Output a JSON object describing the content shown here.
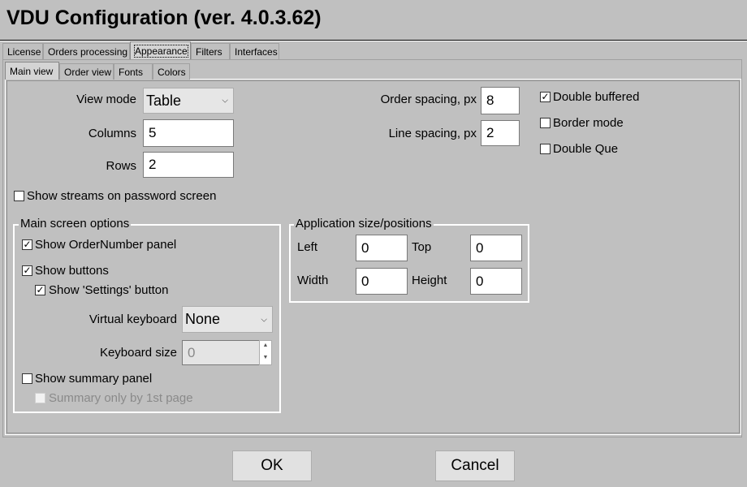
{
  "window": {
    "title": "VDU Configuration (ver. 4.0.3.62)"
  },
  "tabs": [
    {
      "label": "License"
    },
    {
      "label": "Orders processing"
    },
    {
      "label": "Appearance"
    },
    {
      "label": "Filters"
    },
    {
      "label": "Interfaces"
    }
  ],
  "subtabs": [
    {
      "label": "Main view"
    },
    {
      "label": "Order view"
    },
    {
      "label": "Fonts"
    },
    {
      "label": "Colors"
    }
  ],
  "main_view": {
    "view_mode_label": "View mode",
    "view_mode_value": "Table",
    "columns_label": "Columns",
    "columns_value": "5",
    "rows_label": "Rows",
    "rows_value": "2",
    "order_spacing_label": "Order spacing, px",
    "order_spacing_value": "8",
    "line_spacing_label": "Line spacing, px",
    "line_spacing_value": "2",
    "double_buffered": {
      "label": "Double buffered",
      "checked": true
    },
    "border_mode": {
      "label": "Border mode",
      "checked": false
    },
    "double_que": {
      "label": "Double Que",
      "checked": false
    },
    "show_streams": {
      "label": "Show streams on password screen",
      "checked": false
    }
  },
  "main_screen_options": {
    "title": "Main screen options",
    "show_ordernumber_panel": {
      "label": "Show OrderNumber panel",
      "checked": true
    },
    "show_buttons": {
      "label": "Show buttons",
      "checked": true
    },
    "show_settings_button": {
      "label": "Show 'Settings' button",
      "checked": true
    },
    "virtual_keyboard_label": "Virtual keyboard",
    "virtual_keyboard_value": "None",
    "keyboard_size_label": "Keyboard size",
    "keyboard_size_value": "0",
    "show_summary_panel": {
      "label": "Show summary panel",
      "checked": false
    },
    "summary_only_first_page": {
      "label": "Summary only by 1st page",
      "checked": false
    }
  },
  "app_size": {
    "title": "Application size/positions",
    "left_label": "Left",
    "left_value": "0",
    "top_label": "Top",
    "top_value": "0",
    "width_label": "Width",
    "width_value": "0",
    "height_label": "Height",
    "height_value": "0"
  },
  "footer": {
    "ok_label": "OK",
    "cancel_label": "Cancel"
  },
  "glyphs": {
    "check": "✓",
    "dropdown": "⌵",
    "spin_up": "▲",
    "spin_down": "▼"
  }
}
